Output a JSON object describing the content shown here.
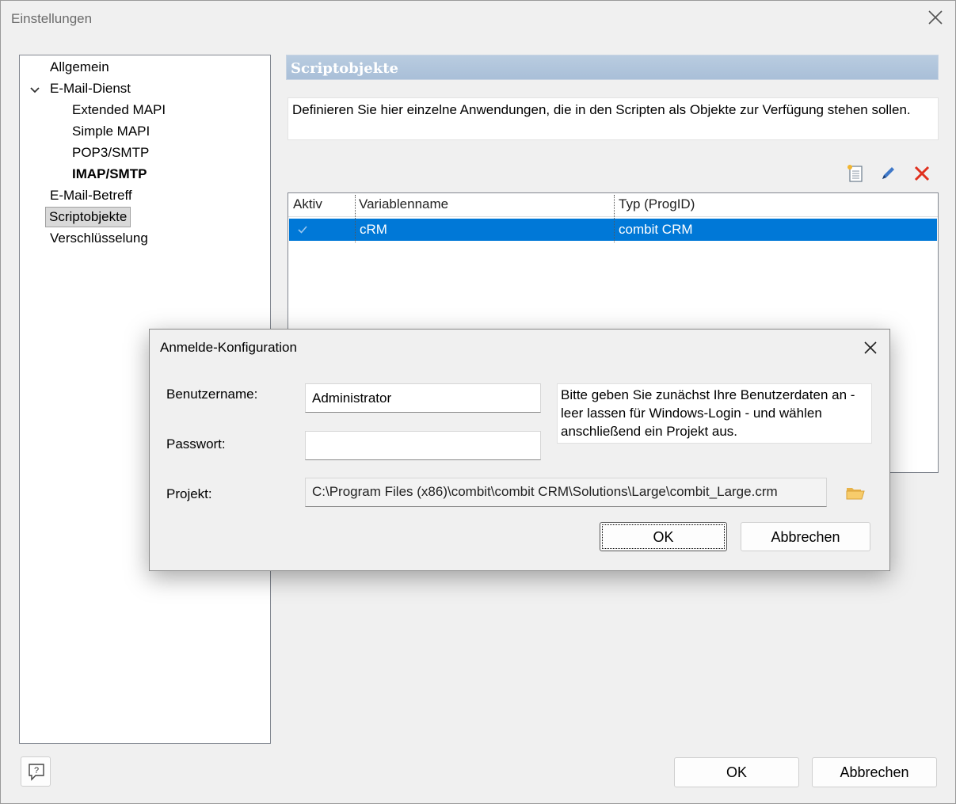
{
  "window": {
    "title": "Einstellungen"
  },
  "tree": {
    "items": [
      {
        "label": "Allgemein"
      },
      {
        "label": "E-Mail-Dienst"
      },
      {
        "label": "Extended MAPI"
      },
      {
        "label": "Simple MAPI"
      },
      {
        "label": "POP3/SMTP"
      },
      {
        "label": "IMAP/SMTP"
      },
      {
        "label": "E-Mail-Betreff"
      },
      {
        "label": "Scriptobjekte"
      },
      {
        "label": "Verschlüsselung"
      }
    ],
    "selected": "Scriptobjekte",
    "bold": "IMAP/SMTP"
  },
  "panel": {
    "header": "Scriptobjekte",
    "description": "Definieren Sie hier einzelne Anwendungen, die in den Scripten als Objekte zur Verfügung stehen sollen.",
    "toolbar": {
      "icons": [
        "new-document-icon",
        "edit-pencil-icon",
        "delete-x-icon"
      ]
    },
    "grid": {
      "columns": [
        "Aktiv",
        "Variablenname",
        "Typ (ProgID)"
      ],
      "rows": [
        {
          "active": true,
          "name": "cRM",
          "type": "combit CRM"
        }
      ]
    }
  },
  "footer": {
    "ok": "OK",
    "cancel": "Abbrechen"
  },
  "modal": {
    "title": "Anmelde-Konfiguration",
    "username_label": "Benutzername:",
    "username_value": "Administrator",
    "password_label": "Passwort:",
    "password_value": "",
    "project_label": "Projekt:",
    "project_value": "C:\\Program Files (x86)\\combit\\combit CRM\\Solutions\\Large\\combit_Large.crm",
    "hint": "Bitte geben Sie zunächst Ihre Benutzerdaten an - leer lassen für Windows-Login - und wählen anschließend ein Projekt aus.",
    "ok": "OK",
    "cancel": "Abbrechen"
  },
  "colors": {
    "selection": "#0078d7",
    "header": "#b0c4dc",
    "delete": "#e0301e"
  }
}
